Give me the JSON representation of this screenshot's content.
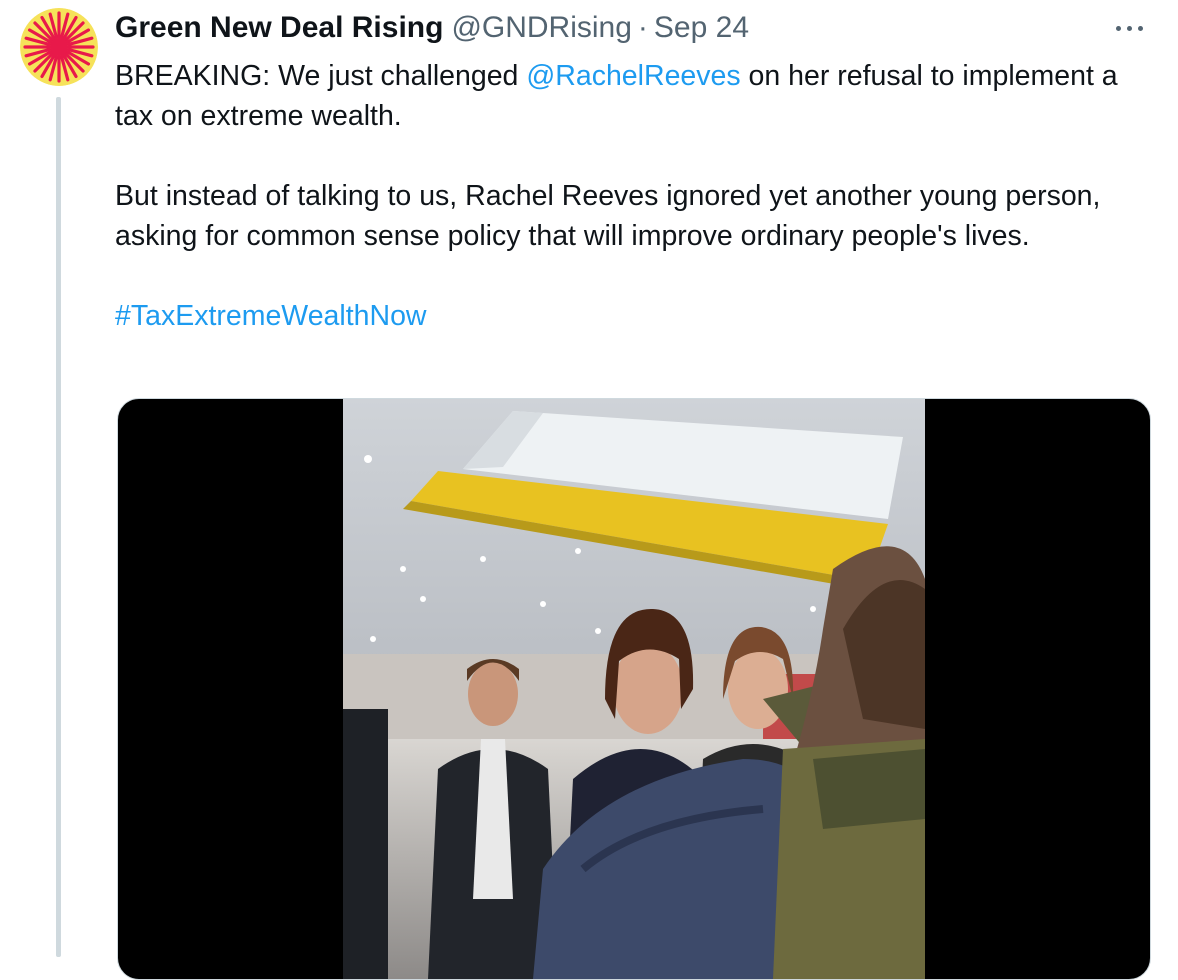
{
  "author": {
    "name": "Green New Deal Rising",
    "handle": "@GNDRising",
    "separator": "·",
    "date": "Sep 24"
  },
  "tweet": {
    "line1_prefix": "BREAKING: We just challenged ",
    "mention": "@RachelReeves",
    "line1_suffix": " on her refusal to implement a tax on extreme wealth.",
    "paragraph2": "But instead of talking to us, Rachel Reeves ignored yet another young person, asking for common sense policy that will improve ordinary people's lives.",
    "hashtag": "#TaxExtremeWealthNow"
  },
  "icons": {
    "more": "more-horizontal-icon",
    "avatar": "sun-rays-logo"
  },
  "colors": {
    "link": "#1d9bf0",
    "secondary_text": "#536471",
    "avatar_bg": "#f6e25a",
    "avatar_rays": "#e8194a"
  }
}
